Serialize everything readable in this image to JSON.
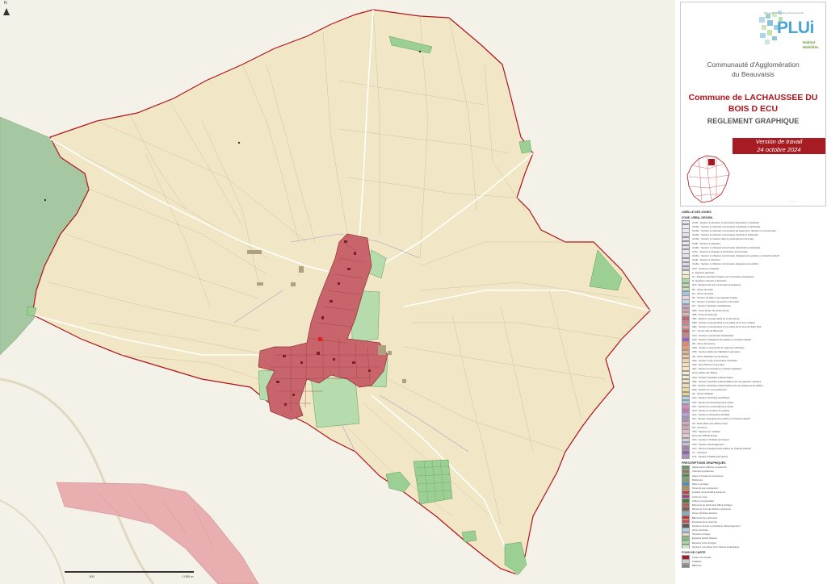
{
  "map": {
    "north_label": "N",
    "scale_labels": [
      "100",
      "1 000 m"
    ]
  },
  "header": {
    "logo_text": "PLUi",
    "logo_small": "Plan Local d'Urbanisme Intercommunal",
    "logo_sub1": "Habitat",
    "logo_sub2": "Mobilités",
    "agglomeration_line1": "Communauté d'Agglomération",
    "agglomeration_line2": "du Beauvaisis",
    "commune_line1": "Commune de LACHAUSSEE DU",
    "commune_line2": "BOIS D ECU",
    "document_title": "REGLEMENT GRAPHIQUE",
    "version_line1": "Version de travail",
    "version_line2": "24 octobre 2024"
  },
  "legend": {
    "title": "LIBELLE DES ZONES",
    "section_zones": "ZONE, URBA, DESIGN",
    "section_prescriptions": "PRESCRIPTIONS GRAPHIQUES",
    "section_fond": "FOND DE CARTE",
    "zone_items": [
      {
        "label": "UCdb : Secteur à urbaniser à dominante industrielle et artisanale",
        "color": "#e8e4f2"
      },
      {
        "label": "UCdby : Secteur à urbaniser à dominante industrielle et artisanale",
        "color": "#ede8f5"
      },
      {
        "label": "UCdbx : Secteur à urbaniser à dominante de logements, urbaine ou commerciale",
        "color": "#ebe6f3"
      },
      {
        "label": "UCdby : Secteur à urbaniser à dominante d'activité et artisanale",
        "color": "#e4dff0"
      },
      {
        "label": "UCdby : Secteur à vocation dans le prolongement du bourg",
        "color": "#e9e5f4"
      },
      {
        "label": "UAdb : Secteur à urbaniser",
        "color": "#f0e6f2"
      },
      {
        "label": "UAdby : Secteur à urbaniser à dominante industrielle et artisanale",
        "color": "#e8e0ef"
      },
      {
        "label": "UAby : Secteur à urbaniser à dominante commerciale",
        "color": "#eee3f2"
      },
      {
        "label": "UAdby : Secteur à urbaniser à dominante d'équipements publics ou d'intérêt collectif",
        "color": "#e6ddee"
      },
      {
        "label": "UAdb : Secteur à urbaniser",
        "color": "#ece6f0"
      },
      {
        "label": "UAdby : Secteur à urbaniser à dominante d'équipements publics",
        "color": "#e2dbea"
      },
      {
        "label": "UAX : Secteur à urbaniser",
        "color": "#d7cde3"
      },
      {
        "label": "A : Espaces agricoles",
        "color": "#f2efd8"
      },
      {
        "label": "Ac : Espaces agricoles intégrés aux continuités écologiques",
        "color": "#efe9c8"
      },
      {
        "label": "N : Espaces naturels et forestiers",
        "color": "#a8d9a0"
      },
      {
        "label": "Nbd : Espaces liés aux continuités écologiques",
        "color": "#b6e0ae"
      },
      {
        "label": "Nb : Zones humides",
        "color": "#c3e6bc"
      },
      {
        "label": "Ne : Zones de loisirs",
        "color": "#9bc7e0"
      },
      {
        "label": "Nh : Secteur de taille et de capacité limitées",
        "color": "#f2cfe0"
      },
      {
        "label": "Ns : Secteur à vocation de sports et de loisirs",
        "color": "#b8d8f0"
      },
      {
        "label": "Nm : Secteur d'activités médicalisées",
        "color": "#c2a8d8"
      },
      {
        "label": "UBa : Tissu ancien de centre-bourg",
        "color": "#d9a0a8"
      },
      {
        "label": "UBb : Tissu de faubourg",
        "color": "#e6b4bb"
      },
      {
        "label": "UBc : Secteur correspondant au centre-bourg",
        "color": "#c26571"
      },
      {
        "label": "UBd : Secteur correspondant à une partie de la zone urbaine",
        "color": "#cf8088"
      },
      {
        "label": "UBe : Secteur correspondant à une partie de la zone de Saint Félix",
        "color": "#dea0a5"
      },
      {
        "label": "UC : Centre-ville de Beauvais",
        "color": "#c65a5a"
      },
      {
        "label": "UCa : Secteur à dominante résidentielle",
        "color": "#d47d7d"
      },
      {
        "label": "UCb : Secteur d'équipements publics ou d'intérêt collectif",
        "color": "#a25ec6"
      },
      {
        "label": "UD : Zone d'extension",
        "color": "#df8a6a"
      },
      {
        "label": "UDa : Secteur à dominante de logement individuel",
        "color": "#e89a72"
      },
      {
        "label": "UDb : Secteur dédié aux habitations groupées",
        "color": "#eeb087"
      },
      {
        "label": "UE : Zone d'activités économiques",
        "color": "#f0c9a0"
      },
      {
        "label": "UEa : Secteur mixte à dominante d'activités",
        "color": "#f4d0ad"
      },
      {
        "label": "UEb : Zone Rivière et de projet",
        "color": "#f5dfb4"
      },
      {
        "label": "UEc : Secteur économique à vocation logistique",
        "color": "#f7e6bd"
      },
      {
        "label": "Zone dédiée des Tilleuls",
        "color": "#f7eecb"
      },
      {
        "label": "UEd : Secteur d'activités préférentielles",
        "color": "#f8efd1"
      },
      {
        "label": "UEe : Secteur d'activités préférentielles pour les grandes emprises",
        "color": "#f3e6c2"
      },
      {
        "label": "UEf : Secteur d'activités préférentielles pour les équipements publics",
        "color": "#efdcb3"
      },
      {
        "label": "UEg : Secteur en renouvellement",
        "color": "#f0d9a0"
      },
      {
        "label": "UF : Zones d'habitat",
        "color": "#f2d18c"
      },
      {
        "label": "UFa : Secteur d'activités spécifiques",
        "color": "#b5d4e8"
      },
      {
        "label": "UFb : Secteur de développement urbain",
        "color": "#a8c9e2"
      },
      {
        "label": "UFc : Secteur de renouvellement urbain",
        "color": "#d38dc1"
      },
      {
        "label": "UFd : Secteur à vocation de quartier",
        "color": "#c07ab5"
      },
      {
        "label": "UFe : Secteur à dominante d'habitat",
        "color": "#b8a0d2"
      },
      {
        "label": "UFf : Secteur d'équipements publics ou d'intérêt collectif",
        "color": "#a890c8"
      },
      {
        "label": "UP : Ensembles des collines Vues",
        "color": "#dba8c0"
      },
      {
        "label": "UP : Carrières",
        "color": "#c9a8b5"
      },
      {
        "label": "UPa : Espaces en mutation",
        "color": "#e0b8c8"
      },
      {
        "label": "Zone des ZAE Beauvais",
        "color": "#e8c8d4"
      },
      {
        "label": "UXa : Secteur à l'habitat permanent",
        "color": "#d8d0e8"
      },
      {
        "label": "UXb : Secteur d'aménagement",
        "color": "#c8c0de"
      },
      {
        "label": "UXc : Secteur d'équipements publics ou d'intérêt collectif",
        "color": "#a67bb8"
      },
      {
        "label": "UY : Carrières",
        "color": "#8a6aa8"
      },
      {
        "label": "UYa : Secteur d'habitat permanent",
        "color": "#b090c4"
      }
    ],
    "prescription_items": [
      {
        "label": "Alignements d'arbres à conserver",
        "color": "#6a9a5a"
      },
      {
        "label": "Chemins à préserver",
        "color": "#8a7a5a"
      },
      {
        "label": "Haies et bosquets à préserver",
        "color": "#5a8a4a"
      },
      {
        "label": "Ripisylves",
        "color": "#7aa06a"
      },
      {
        "label": "Mare à protéger",
        "color": "#5a8ab0"
      },
      {
        "label": "Cône de vue à préserver",
        "color": "#b0905a"
      },
      {
        "label": "Linéaire commercial à préserver",
        "color": "#c04040"
      },
      {
        "label": "Limite de zone",
        "color": "#a04080"
      },
      {
        "label": "Arbres remarquables",
        "color": "#4a7a3a"
      },
      {
        "label": "Eléments de patrimoine bâti à protéger",
        "color": "#b06060"
      },
      {
        "label": "Murets et murs de clôture à préserver",
        "color": "#806050"
      },
      {
        "label": "Zones humides avérées",
        "color": "#7ab0d0"
      },
      {
        "label": "Bâtiments de patrimoine",
        "color": "#c83030"
      },
      {
        "label": "Emplacements réservés",
        "color": "#d04a4a"
      },
      {
        "label": "Secteurs soumis à orientation d'aménagement",
        "color": "#5a5a5a"
      },
      {
        "label": "Zones humides",
        "color": "#a8cfe8"
      },
      {
        "label": "Secteurs à risque",
        "color": "#e8d8c0"
      },
      {
        "label": "Espaces boisés classés",
        "color": "#7cc27a"
      },
      {
        "label": "Espaces verts protégés",
        "color": "#a6d8a0"
      },
      {
        "label": "Secteurs à protéger pour raisons écologiques",
        "color": "#c8e8c0"
      }
    ],
    "fond_items": [
      {
        "label": "Limite communale",
        "color": "#a71c22"
      },
      {
        "label": "Cadastre",
        "color": "#cccccc"
      },
      {
        "label": "Bâtiment",
        "color": "#888888"
      }
    ]
  },
  "colors": {
    "agricultural": "#f1e7c6",
    "village": "#c8646c",
    "natural": "#9ccf94",
    "boundary": "#b0121b",
    "road": "#ffffff",
    "green_band": "#a5c7a2",
    "pink_band": "#e8aeb0",
    "outside": "#f4f1e8"
  }
}
